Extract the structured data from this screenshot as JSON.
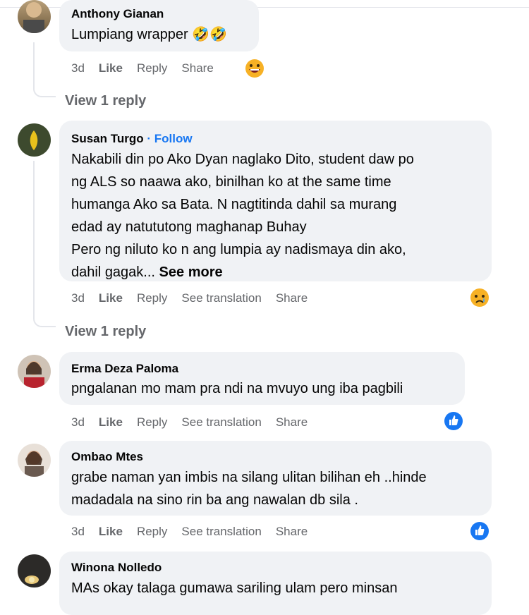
{
  "comments": [
    {
      "author": "Anthony Gianan",
      "lines": [
        "Lumpiang wrapper 🤣🤣"
      ],
      "time": "3d",
      "like": "Like",
      "reply": "Reply",
      "share": "Share",
      "reaction": "grin-emoji"
    },
    {
      "author": "Susan Turgo",
      "follow": "· Follow",
      "lines": [
        "Nakabili din po Ako Dyan naglako Dito, student daw po",
        "ng ALS so naawa ako, binilhan ko at the same time",
        "humanga Ako sa Bata. N nagtitinda dahil sa murang",
        "edad ay natututong maghanap Buhay",
        "Pero ng niluto ko n ang lumpia ay nadismaya din ako,",
        "dahil gagak..."
      ],
      "see_more": "See more",
      "time": "3d",
      "like": "Like",
      "reply": "Reply",
      "translate": "See translation",
      "share": "Share",
      "reaction": "sad-emoji"
    },
    {
      "author": "Erma Deza Paloma",
      "lines": [
        "pngalanan mo mam pra ndi na mvuyo ung iba pagbili"
      ],
      "time": "3d",
      "like": "Like",
      "reply": "Reply",
      "translate": "See translation",
      "share": "Share",
      "reaction": "like-icon"
    },
    {
      "author": "Ombao Mtes",
      "lines": [
        "grabe naman yan imbis na silang ulitan bilihan eh ..hinde",
        "madadala na sino rin ba ang nawalan db sila ."
      ],
      "time": "3d",
      "like": "Like",
      "reply": "Reply",
      "translate": "See translation",
      "share": "Share",
      "reaction": "like-icon"
    },
    {
      "author": "Winona Nolledo",
      "lines": [
        "MAs okay talaga gumawa sariling ulam pero minsan"
      ]
    }
  ],
  "view_replies": [
    "View 1 reply",
    "View 1 reply"
  ],
  "colors": {
    "bubble": "#f0f2f5",
    "muted": "#65676b",
    "link": "#1877f2"
  }
}
